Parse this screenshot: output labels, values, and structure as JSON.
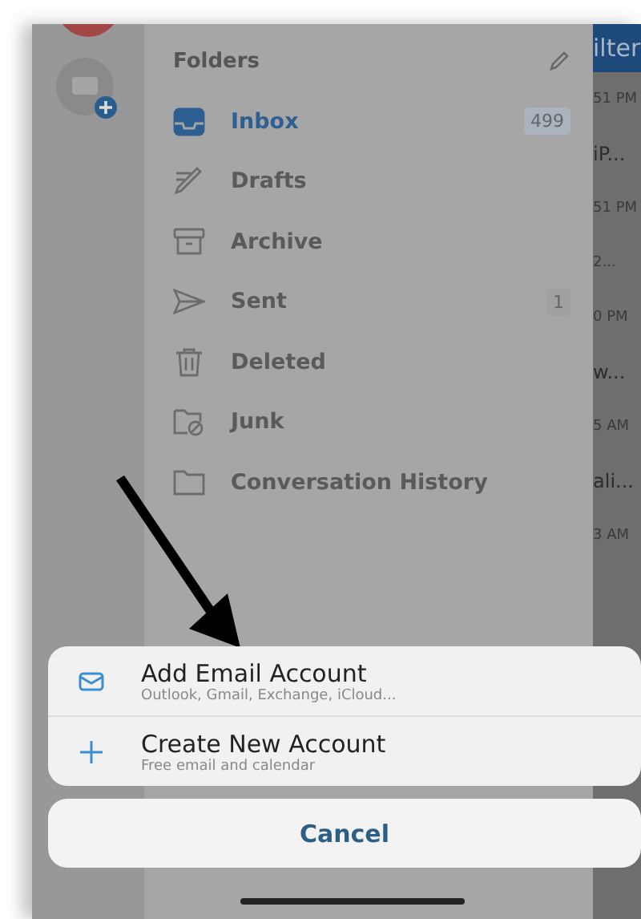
{
  "folders": {
    "title": "Folders",
    "items": [
      {
        "label": "Inbox",
        "kind": "inbox",
        "selected": true,
        "count": "499"
      },
      {
        "label": "Drafts",
        "kind": "drafts",
        "selected": false
      },
      {
        "label": "Archive",
        "kind": "archive",
        "selected": false
      },
      {
        "label": "Sent",
        "kind": "sent",
        "selected": false,
        "count": "1"
      },
      {
        "label": "Deleted",
        "kind": "deleted",
        "selected": false
      },
      {
        "label": "Junk",
        "kind": "junk",
        "selected": false
      },
      {
        "label": "Conversation History",
        "kind": "folder",
        "selected": false
      }
    ]
  },
  "message_list": {
    "header": "ilter",
    "fragments": [
      "51 PM",
      "iP...",
      "51 PM",
      "2...",
      "0 PM",
      "w...",
      "5 AM",
      "ali...",
      "3 AM"
    ]
  },
  "action_sheet": {
    "options": [
      {
        "kind": "mail",
        "title": "Add Email Account",
        "subtitle": "Outlook, Gmail, Exchange, iCloud..."
      },
      {
        "kind": "plus",
        "title": "Create New Account",
        "subtitle": "Free email and calendar"
      }
    ],
    "cancel": "Cancel"
  }
}
